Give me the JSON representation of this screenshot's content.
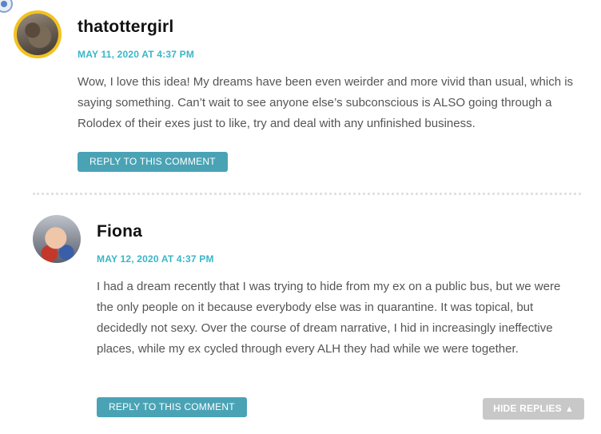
{
  "comments": [
    {
      "author": "thatottergirl",
      "date": "MAY 11, 2020 AT 4:37 PM",
      "body": "Wow, I love this idea! My dreams have been even weirder and more vivid than usual, which is saying something. Can’t wait to see anyone else’s subconscious is ALSO going through a Rolodex of their exes just to like, try and deal with any unfinished business.",
      "reply_label": "REPLY TO THIS COMMENT"
    },
    {
      "author": "Fiona",
      "date": "MAY 12, 2020 AT 4:37 PM",
      "body": "I had a dream recently that I was trying to hide from my ex on a public bus, but we were the only people on it because everybody else was in quarantine. It was topical, but decidedly not sexy. Over the course of dream narrative, I hid in increasingly ineffective places, while my ex cycled through every ALH they had while we were together.",
      "reply_label": "REPLY TO THIS COMMENT"
    }
  ],
  "hide_replies_label": "HIDE REPLIES",
  "hide_replies_icon": "▲",
  "colors": {
    "accent_date": "#3ab6c8",
    "reply_button": "#4aa3b5",
    "hide_replies_button": "#c8c8c8"
  }
}
